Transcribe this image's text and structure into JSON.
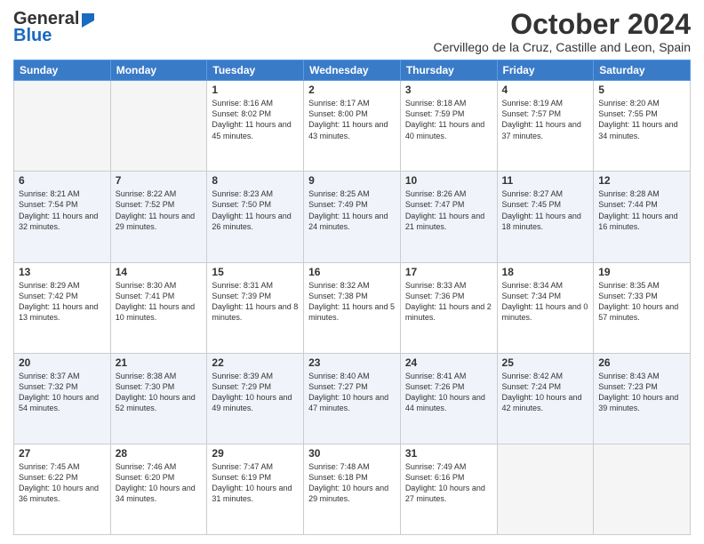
{
  "header": {
    "logo_general": "General",
    "logo_blue": "Blue",
    "month": "October 2024",
    "location": "Cervillego de la Cruz, Castille and Leon, Spain"
  },
  "weekdays": [
    "Sunday",
    "Monday",
    "Tuesday",
    "Wednesday",
    "Thursday",
    "Friday",
    "Saturday"
  ],
  "weeks": [
    [
      {
        "day": "",
        "info": ""
      },
      {
        "day": "",
        "info": ""
      },
      {
        "day": "1",
        "info": "Sunrise: 8:16 AM\nSunset: 8:02 PM\nDaylight: 11 hours and 45 minutes."
      },
      {
        "day": "2",
        "info": "Sunrise: 8:17 AM\nSunset: 8:00 PM\nDaylight: 11 hours and 43 minutes."
      },
      {
        "day": "3",
        "info": "Sunrise: 8:18 AM\nSunset: 7:59 PM\nDaylight: 11 hours and 40 minutes."
      },
      {
        "day": "4",
        "info": "Sunrise: 8:19 AM\nSunset: 7:57 PM\nDaylight: 11 hours and 37 minutes."
      },
      {
        "day": "5",
        "info": "Sunrise: 8:20 AM\nSunset: 7:55 PM\nDaylight: 11 hours and 34 minutes."
      }
    ],
    [
      {
        "day": "6",
        "info": "Sunrise: 8:21 AM\nSunset: 7:54 PM\nDaylight: 11 hours and 32 minutes."
      },
      {
        "day": "7",
        "info": "Sunrise: 8:22 AM\nSunset: 7:52 PM\nDaylight: 11 hours and 29 minutes."
      },
      {
        "day": "8",
        "info": "Sunrise: 8:23 AM\nSunset: 7:50 PM\nDaylight: 11 hours and 26 minutes."
      },
      {
        "day": "9",
        "info": "Sunrise: 8:25 AM\nSunset: 7:49 PM\nDaylight: 11 hours and 24 minutes."
      },
      {
        "day": "10",
        "info": "Sunrise: 8:26 AM\nSunset: 7:47 PM\nDaylight: 11 hours and 21 minutes."
      },
      {
        "day": "11",
        "info": "Sunrise: 8:27 AM\nSunset: 7:45 PM\nDaylight: 11 hours and 18 minutes."
      },
      {
        "day": "12",
        "info": "Sunrise: 8:28 AM\nSunset: 7:44 PM\nDaylight: 11 hours and 16 minutes."
      }
    ],
    [
      {
        "day": "13",
        "info": "Sunrise: 8:29 AM\nSunset: 7:42 PM\nDaylight: 11 hours and 13 minutes."
      },
      {
        "day": "14",
        "info": "Sunrise: 8:30 AM\nSunset: 7:41 PM\nDaylight: 11 hours and 10 minutes."
      },
      {
        "day": "15",
        "info": "Sunrise: 8:31 AM\nSunset: 7:39 PM\nDaylight: 11 hours and 8 minutes."
      },
      {
        "day": "16",
        "info": "Sunrise: 8:32 AM\nSunset: 7:38 PM\nDaylight: 11 hours and 5 minutes."
      },
      {
        "day": "17",
        "info": "Sunrise: 8:33 AM\nSunset: 7:36 PM\nDaylight: 11 hours and 2 minutes."
      },
      {
        "day": "18",
        "info": "Sunrise: 8:34 AM\nSunset: 7:34 PM\nDaylight: 11 hours and 0 minutes."
      },
      {
        "day": "19",
        "info": "Sunrise: 8:35 AM\nSunset: 7:33 PM\nDaylight: 10 hours and 57 minutes."
      }
    ],
    [
      {
        "day": "20",
        "info": "Sunrise: 8:37 AM\nSunset: 7:32 PM\nDaylight: 10 hours and 54 minutes."
      },
      {
        "day": "21",
        "info": "Sunrise: 8:38 AM\nSunset: 7:30 PM\nDaylight: 10 hours and 52 minutes."
      },
      {
        "day": "22",
        "info": "Sunrise: 8:39 AM\nSunset: 7:29 PM\nDaylight: 10 hours and 49 minutes."
      },
      {
        "day": "23",
        "info": "Sunrise: 8:40 AM\nSunset: 7:27 PM\nDaylight: 10 hours and 47 minutes."
      },
      {
        "day": "24",
        "info": "Sunrise: 8:41 AM\nSunset: 7:26 PM\nDaylight: 10 hours and 44 minutes."
      },
      {
        "day": "25",
        "info": "Sunrise: 8:42 AM\nSunset: 7:24 PM\nDaylight: 10 hours and 42 minutes."
      },
      {
        "day": "26",
        "info": "Sunrise: 8:43 AM\nSunset: 7:23 PM\nDaylight: 10 hours and 39 minutes."
      }
    ],
    [
      {
        "day": "27",
        "info": "Sunrise: 7:45 AM\nSunset: 6:22 PM\nDaylight: 10 hours and 36 minutes."
      },
      {
        "day": "28",
        "info": "Sunrise: 7:46 AM\nSunset: 6:20 PM\nDaylight: 10 hours and 34 minutes."
      },
      {
        "day": "29",
        "info": "Sunrise: 7:47 AM\nSunset: 6:19 PM\nDaylight: 10 hours and 31 minutes."
      },
      {
        "day": "30",
        "info": "Sunrise: 7:48 AM\nSunset: 6:18 PM\nDaylight: 10 hours and 29 minutes."
      },
      {
        "day": "31",
        "info": "Sunrise: 7:49 AM\nSunset: 6:16 PM\nDaylight: 10 hours and 27 minutes."
      },
      {
        "day": "",
        "info": ""
      },
      {
        "day": "",
        "info": ""
      }
    ]
  ]
}
